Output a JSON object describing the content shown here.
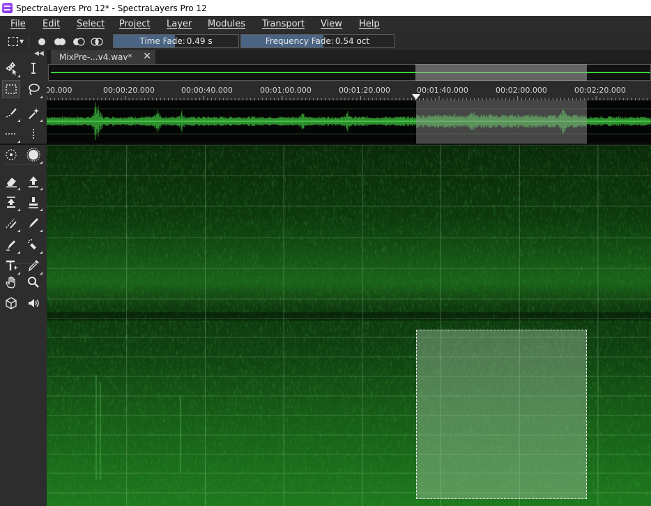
{
  "window": {
    "title": "SpectraLayers Pro 12* - SpectraLayers Pro 12"
  },
  "menu": [
    "File",
    "Edit",
    "Select",
    "Project",
    "Layer",
    "Modules",
    "Transport",
    "View",
    "Help"
  ],
  "options": {
    "time_fade_label": "Time Fade:",
    "time_fade_value": "0.49 s",
    "time_fade_fill": 0.49,
    "freq_fade_label": "Frequency Fade:",
    "freq_fade_value": "0.54 oct",
    "freq_fade_fill": 0.54
  },
  "tab": {
    "label": "MixPre-...v4.wav*",
    "close": "✕"
  },
  "ruler": {
    "labels": [
      "00.000",
      "00:00:20.000",
      "00:00:40.000",
      "00:01:00.000",
      "00:01:20.000",
      "00:01:40.000",
      "00:02:00.000",
      "00:02:20.000"
    ]
  },
  "tools": [
    "move-tool",
    "time-select-tool",
    "rectangle-select-tool",
    "lasso-tool",
    "brush-select-tool",
    "magic-wand-tool",
    "frequency-select-tool",
    "harmonic-select-tool",
    "circle-select-tool",
    "sound-select-tool",
    "eraser-tool",
    "extract-tool",
    "amplitude-tool",
    "clone-stamp-tool",
    "smudge-tool",
    "pencil-tool",
    "draw-tool",
    "spray-tool",
    "text-tool",
    "eyedropper-tool",
    "hand-tool",
    "zoom-tool",
    "3d-view-tool",
    "speaker-tool"
  ],
  "colors": {
    "accent_green": "#36d336",
    "selection_fill": "#4a6484"
  }
}
